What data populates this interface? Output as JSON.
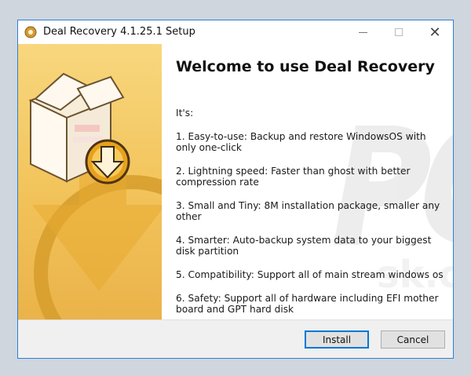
{
  "window": {
    "title": "Deal Recovery 4.1.25.1 Setup",
    "controls": {
      "minimize": "minimize",
      "maximize": "maximize",
      "close": "✕"
    }
  },
  "content": {
    "heading": "Welcome to use Deal Recovery",
    "intro": "It's:",
    "items": [
      "1. Easy-to-use: Backup and restore WindowsOS with only one-click",
      "2. Lightning speed: Faster than ghost with better compression rate",
      "3. Small and Tiny: 8M installation package, smaller any other",
      "4. Smarter: Auto-backup system data to your biggest disk partition",
      "5. Compatibility: Support all of main stream windows os",
      "6. Safety: Support all of hardware including EFI mother board and GPT hard disk"
    ]
  },
  "buttons": {
    "install": "Install",
    "cancel": "Cancel"
  },
  "colors": {
    "accent": "#0078d7",
    "panel": "#f2c35a",
    "arrow": "#e7a92f"
  },
  "icons": {
    "app": "setup-disc-icon",
    "box": "software-box-icon",
    "download": "download-arrow-icon"
  }
}
